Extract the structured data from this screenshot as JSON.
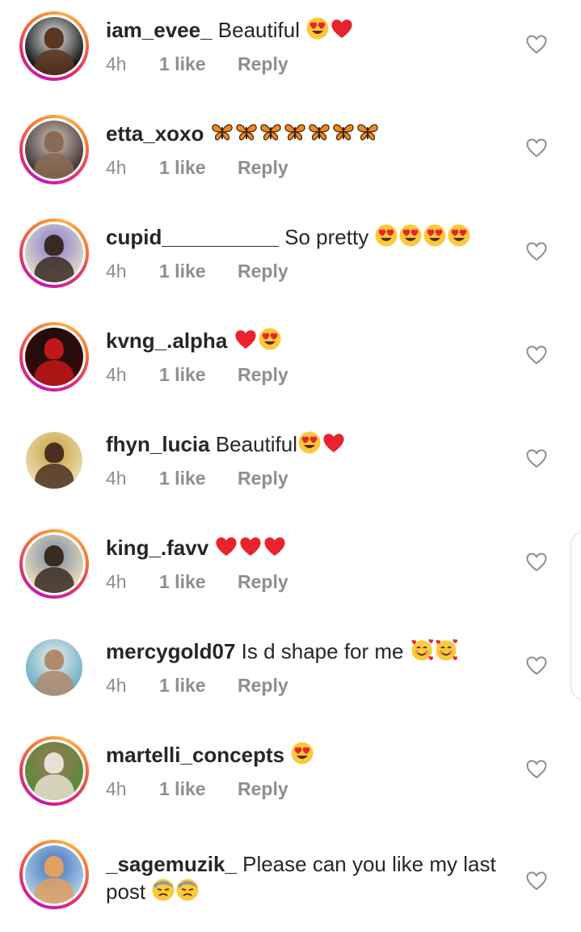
{
  "comments": [
    {
      "username": "iam_evee_",
      "text": " Beautiful ",
      "emojis": [
        "heart-eyes-emoji",
        "red-heart-emoji"
      ],
      "time": "4h",
      "likes": "1 like",
      "reply": "Reply",
      "avatar": {
        "ring": true,
        "bg": "#1a1a1a",
        "skin": "#5a3620",
        "accent": "#e8e8e8"
      }
    },
    {
      "username": "etta_xoxo",
      "text": " ",
      "emojis": [
        "butterfly-emoji",
        "butterfly-emoji",
        "butterfly-emoji",
        "butterfly-emoji",
        "butterfly-emoji",
        "butterfly-emoji",
        "butterfly-emoji"
      ],
      "time": "4h",
      "likes": "1 like",
      "reply": "Reply",
      "avatar": {
        "ring": true,
        "bg": "#4a3a3a",
        "skin": "#8a6a52",
        "accent": "#cfc7bf"
      }
    },
    {
      "username": "cupid__________",
      "text": " So pretty ",
      "emojis": [
        "heart-eyes-emoji",
        "heart-eyes-emoji",
        "heart-eyes-emoji",
        "heart-eyes-emoji"
      ],
      "time": "4h",
      "likes": "1 like",
      "reply": "Reply",
      "avatar": {
        "ring": true,
        "bg": "#d9d4c6",
        "skin": "#3b2a22",
        "accent": "#8a7ad0"
      }
    },
    {
      "username": "kvng_.alpha",
      "text": " ",
      "emojis": [
        "red-heart-emoji",
        "heart-eyes-emoji"
      ],
      "time": "4h",
      "likes": "1 like",
      "reply": "Reply",
      "avatar": {
        "ring": true,
        "bg": "#3a0808",
        "skin": "#c01818",
        "accent": "#111111"
      }
    },
    {
      "username": "fhyn_lucia",
      "text": " Beautiful",
      "emojis": [
        "heart-eyes-emoji",
        "red-heart-emoji"
      ],
      "time": "4h",
      "likes": "1 like",
      "reply": "Reply",
      "avatar": {
        "ring": false,
        "bg": "#e8d9a8",
        "skin": "#4a3020",
        "accent": "#c7a040"
      }
    },
    {
      "username": "king_.favv",
      "text": " ",
      "emojis": [
        "red-heart-emoji",
        "red-heart-emoji",
        "red-heart-emoji"
      ],
      "time": "4h",
      "likes": "1 like",
      "reply": "Reply",
      "avatar": {
        "ring": true,
        "bg": "#e0d8b8",
        "skin": "#3a2a20",
        "accent": "#7a8aa8"
      }
    },
    {
      "username": "mercygold07",
      "text": " Is d shape for me ",
      "emojis": [
        "smiling-face-hearts-emoji",
        "smiling-face-hearts-emoji"
      ],
      "time": "4h",
      "likes": "1 like",
      "reply": "Reply",
      "avatar": {
        "ring": false,
        "bg": "#6fb2c8",
        "skin": "#b08a6e",
        "accent": "#f0ede8"
      }
    },
    {
      "username": "martelli_concepts",
      "text": " ",
      "emojis": [
        "heart-eyes-emoji"
      ],
      "time": "4h",
      "likes": "1 like",
      "reply": "Reply",
      "avatar": {
        "ring": true,
        "bg": "#5a8a3a",
        "skin": "#e8e0d0",
        "accent": "#9a7a55"
      }
    },
    {
      "username": "_sagemuzik_",
      "text": " Please can you like  my last post ",
      "emojis": [
        "downcast-sweat-emoji",
        "downcast-sweat-emoji"
      ],
      "time": "",
      "likes": "",
      "reply": "",
      "avatar": {
        "ring": true,
        "bg": "#a8c8e0",
        "skin": "#e0a060",
        "accent": "#4070c0"
      }
    }
  ],
  "colors": {
    "text": "#262626",
    "meta": "#8e8e8e",
    "heart_red": "#e8232e",
    "emoji_yellow": "#fbc93a",
    "butterfly_orange": "#f08a1c"
  }
}
